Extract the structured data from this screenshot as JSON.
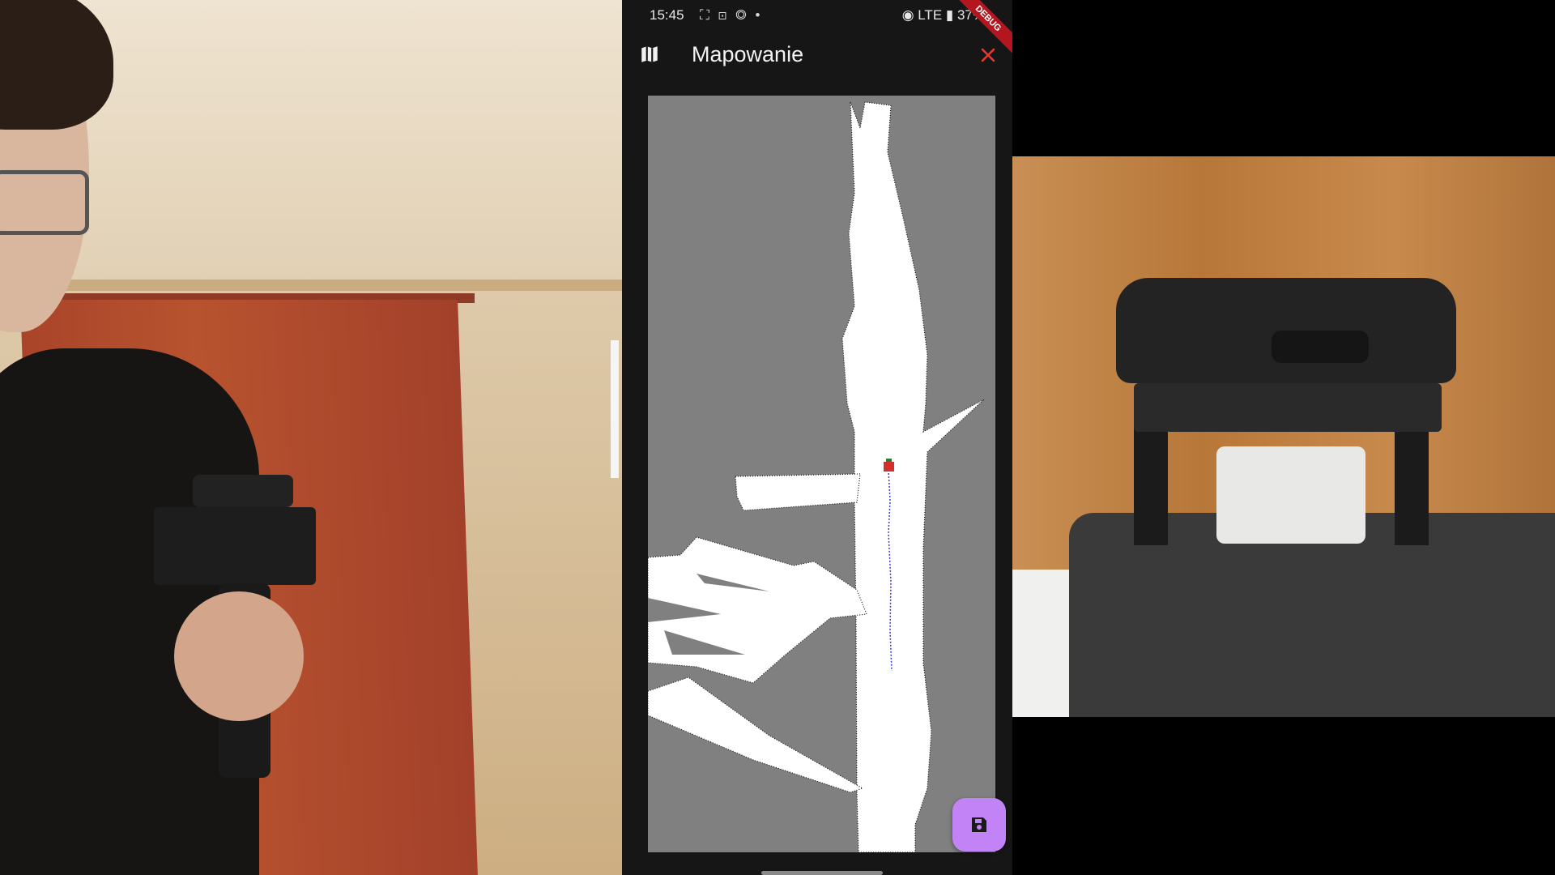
{
  "status_bar": {
    "time": "15:45",
    "notification_icons": "⛶ ⊡ ◎ •",
    "system_indicators": "◉ LTE ▮ 37%",
    "debug_banner": "DEBUG"
  },
  "app_bar": {
    "title": "Mapowanie",
    "leading_icon": "map-icon",
    "close_icon": "close-icon",
    "close_color": "#e53935"
  },
  "map": {
    "unknown_color": "#808080",
    "free_color": "#ffffff",
    "robot_marker_color": "#d32f2f",
    "path_color": "#3b3bd6"
  },
  "fab": {
    "icon": "save-icon",
    "color": "#c183f5"
  }
}
